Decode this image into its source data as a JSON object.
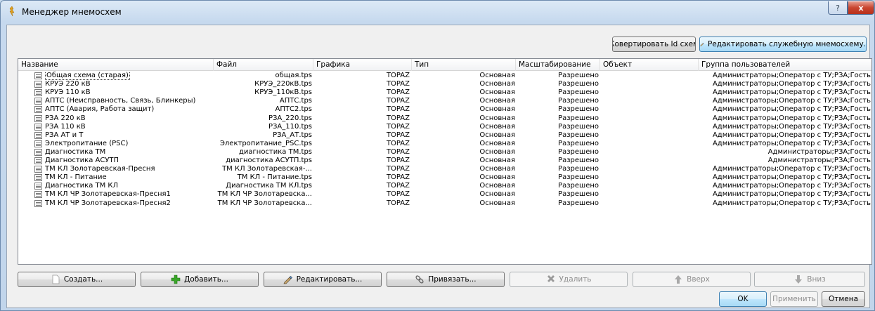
{
  "window": {
    "title": "Менеджер мнемосхем",
    "help_label": "?",
    "close_label": "x"
  },
  "toolbar": {
    "convert_label": "Ковертировать Id схем",
    "edit_service_label": "Редактировать служебную мнемосхему."
  },
  "table": {
    "columns": [
      "Название",
      "Файл",
      "Графика",
      "Тип",
      "Масштабирование",
      "Объект",
      "Группа пользователей"
    ],
    "rows": [
      {
        "name": "Общая схема (старая)",
        "file": "общая.tps",
        "graphics": "TOPAZ",
        "type": "Основная",
        "scaling": "Разрешено",
        "object": "",
        "group": "Администраторы;Оператор с ТУ;РЗА;Гость"
      },
      {
        "name": "КРУЭ 220 кВ",
        "file": "КРУЭ_220кВ.tps",
        "graphics": "TOPAZ",
        "type": "Основная",
        "scaling": "Разрешено",
        "object": "",
        "group": "Администраторы;Оператор с ТУ;РЗА;Гость"
      },
      {
        "name": "КРУЭ 110 кВ",
        "file": "КРУЭ_110кВ.tps",
        "graphics": "TOPAZ",
        "type": "Основная",
        "scaling": "Разрешено",
        "object": "",
        "group": "Администраторы;Оператор с ТУ;РЗА;Гость"
      },
      {
        "name": "АПТС (Неисправность, Связь, Блинкеры)",
        "file": "АПТС.tps",
        "graphics": "TOPAZ",
        "type": "Основная",
        "scaling": "Разрешено",
        "object": "",
        "group": "Администраторы;Оператор с ТУ;РЗА;Гость"
      },
      {
        "name": "АПТС (Авария, Работа защит)",
        "file": "АПТС2.tps",
        "graphics": "TOPAZ",
        "type": "Основная",
        "scaling": "Разрешено",
        "object": "",
        "group": "Администраторы;Оператор с ТУ;РЗА;Гость"
      },
      {
        "name": "РЗА 220 кВ",
        "file": "РЗА_220.tps",
        "graphics": "TOPAZ",
        "type": "Основная",
        "scaling": "Разрешено",
        "object": "",
        "group": "Администраторы;Оператор с ТУ;РЗА;Гость"
      },
      {
        "name": "РЗА 110 кВ",
        "file": "РЗА_110.tps",
        "graphics": "TOPAZ",
        "type": "Основная",
        "scaling": "Разрешено",
        "object": "",
        "group": "Администраторы;Оператор с ТУ;РЗА;Гость"
      },
      {
        "name": "РЗА АТ и Т",
        "file": "РЗА_АТ.tps",
        "graphics": "TOPAZ",
        "type": "Основная",
        "scaling": "Разрешено",
        "object": "",
        "group": "Администраторы;Оператор с ТУ;РЗА;Гость"
      },
      {
        "name": "Электропитание (PSC)",
        "file": "Электропитание_PSC.tps",
        "graphics": "TOPAZ",
        "type": "Основная",
        "scaling": "Разрешено",
        "object": "",
        "group": "Администраторы;Оператор с ТУ;РЗА;Гость"
      },
      {
        "name": "Диагностика ТМ",
        "file": "диагностика ТМ.tps",
        "graphics": "TOPAZ",
        "type": "Основная",
        "scaling": "Разрешено",
        "object": "",
        "group": "Администраторы;РЗА;Гость"
      },
      {
        "name": "Диагностика АСУТП",
        "file": "диагностика АСУТП.tps",
        "graphics": "TOPAZ",
        "type": "Основная",
        "scaling": "Разрешено",
        "object": "",
        "group": "Администраторы;РЗА;Гость"
      },
      {
        "name": "ТМ КЛ Золотаревская-Пресня",
        "file": "ТМ КЛ Золотаревская-...",
        "graphics": "TOPAZ",
        "type": "Основная",
        "scaling": "Разрешено",
        "object": "",
        "group": "Администраторы;Оператор с ТУ;РЗА;Гость"
      },
      {
        "name": "ТМ КЛ - Питание",
        "file": "ТМ КЛ - Питание.tps",
        "graphics": "TOPAZ",
        "type": "Основная",
        "scaling": "Разрешено",
        "object": "",
        "group": "Администраторы;Оператор с ТУ;РЗА;Гость"
      },
      {
        "name": "Диагностика ТМ КЛ",
        "file": "Диагностика ТМ КЛ.tps",
        "graphics": "TOPAZ",
        "type": "Основная",
        "scaling": "Разрешено",
        "object": "",
        "group": "Администраторы;Оператор с ТУ;РЗА;Гость"
      },
      {
        "name": "ТМ КЛ ЧР Золотаревская-Пресня1",
        "file": "ТМ КЛ ЧР Золотаревска...",
        "graphics": "TOPAZ",
        "type": "Основная",
        "scaling": "Разрешено",
        "object": "",
        "group": "Администраторы;Оператор с ТУ;РЗА;Гость"
      },
      {
        "name": "ТМ КЛ ЧР Золотаревская-Пресня2",
        "file": "ТМ КЛ ЧР Золотаревска...",
        "graphics": "TOPAZ",
        "type": "Основная",
        "scaling": "Разрешено",
        "object": "",
        "group": "Администраторы;Оператор с ТУ;РЗА;Гость"
      }
    ]
  },
  "actions": {
    "create_label": "Создать...",
    "add_label": "Добавить...",
    "edit_label": "Редактировать...",
    "bind_label": "Привязать...",
    "delete_label": "Удалить",
    "up_label": "Вверх",
    "down_label": "Вниз"
  },
  "dialog": {
    "ok_label": "OK",
    "apply_label": "Применить",
    "cancel_label": "Отмена"
  },
  "colors": {
    "add_icon": "#3aa62a",
    "delete_icon": "#8d8d8d"
  }
}
